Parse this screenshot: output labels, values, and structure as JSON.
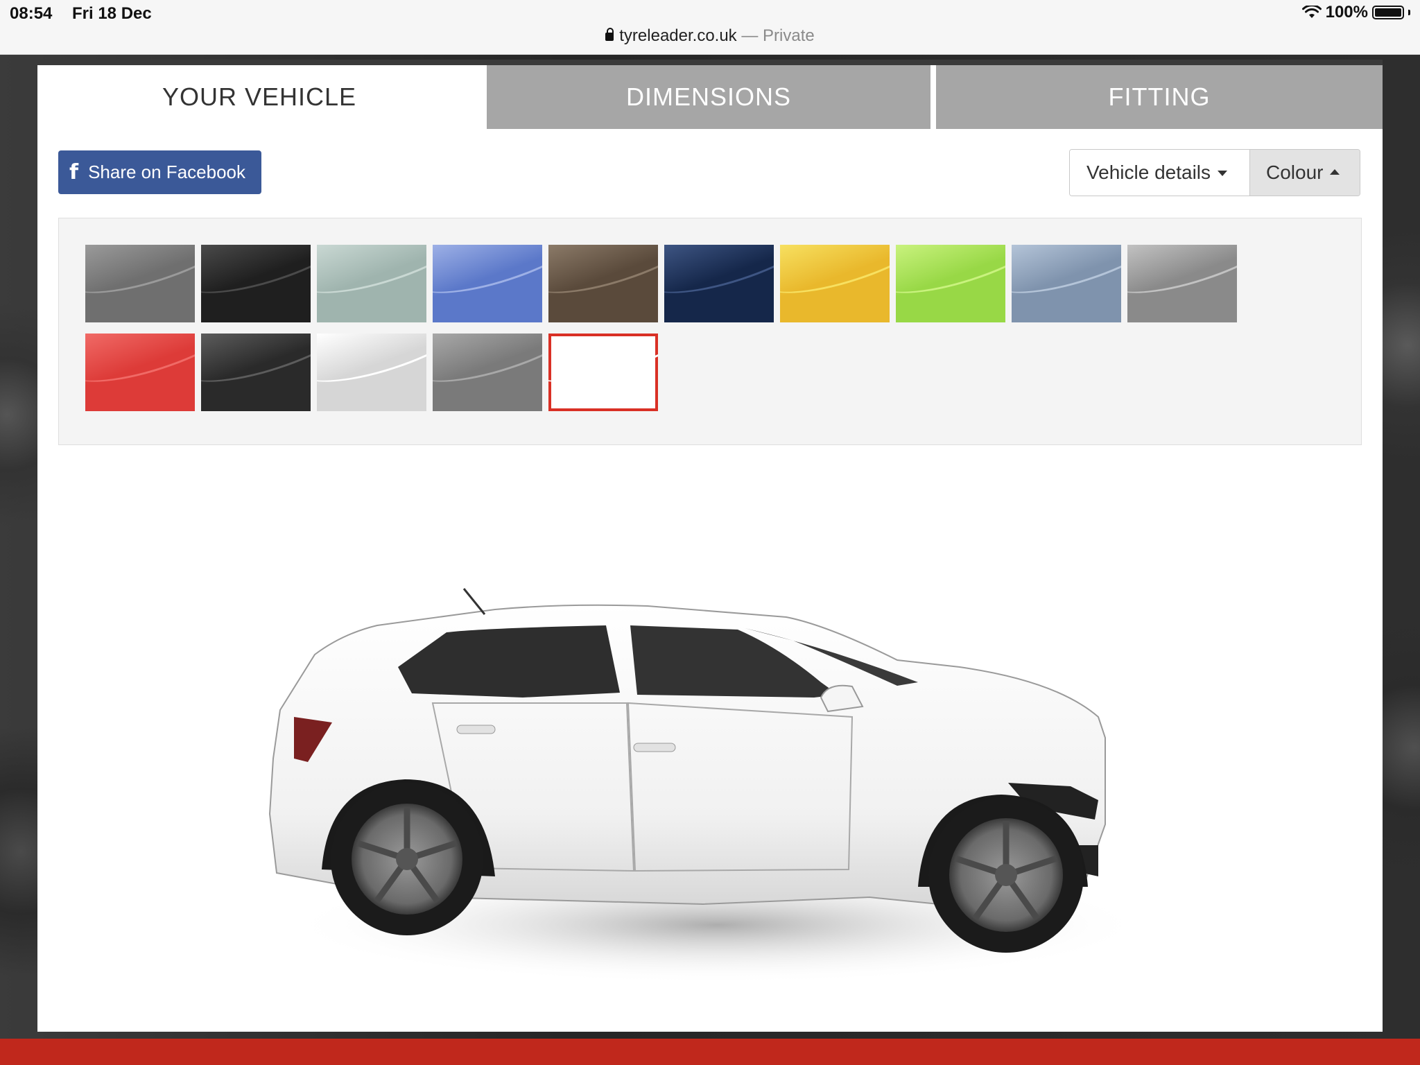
{
  "status_bar": {
    "time": "08:54",
    "date": "Fri 18 Dec",
    "battery": "100%",
    "url": "tyreleader.co.uk",
    "url_suffix": "— Private"
  },
  "tabs": [
    {
      "label": "YOUR VEHICLE",
      "active": true
    },
    {
      "label": "DIMENSIONS",
      "active": false
    },
    {
      "label": "FITTING",
      "active": false
    }
  ],
  "toolbar": {
    "facebook_label": "Share on Facebook",
    "vehicle_details_label": "Vehicle details",
    "colour_label": "Colour"
  },
  "swatches": [
    {
      "color": "#6f6f6f",
      "shine": "#9a9a9a"
    },
    {
      "color": "#1f1f1f",
      "shine": "#4a4a4a"
    },
    {
      "color": "#9fb4ae",
      "shine": "#c9d8d3"
    },
    {
      "color": "#5b78c9",
      "shine": "#9db0e6"
    },
    {
      "color": "#5a4a3b",
      "shine": "#8b7a68"
    },
    {
      "color": "#15274a",
      "shine": "#3e5583"
    },
    {
      "color": "#e9b82c",
      "shine": "#f7e060"
    },
    {
      "color": "#98d846",
      "shine": "#c9f27e"
    },
    {
      "color": "#7f93ad",
      "shine": "#b4c4d8"
    },
    {
      "color": "#8a8a8a",
      "shine": "#c2c2c2"
    },
    {
      "color": "#dd3b38",
      "shine": "#f06a66"
    },
    {
      "color": "#2a2a2a",
      "shine": "#5c5c5c"
    },
    {
      "color": "#d6d6d6",
      "shine": "#ffffff"
    },
    {
      "color": "#7a7a7a",
      "shine": "#a8a8a8"
    },
    {
      "color": "#ffffff",
      "shine": "#ffffff",
      "selected": true
    }
  ],
  "accent_color": "#d93025",
  "facebook_color": "#3b5998"
}
